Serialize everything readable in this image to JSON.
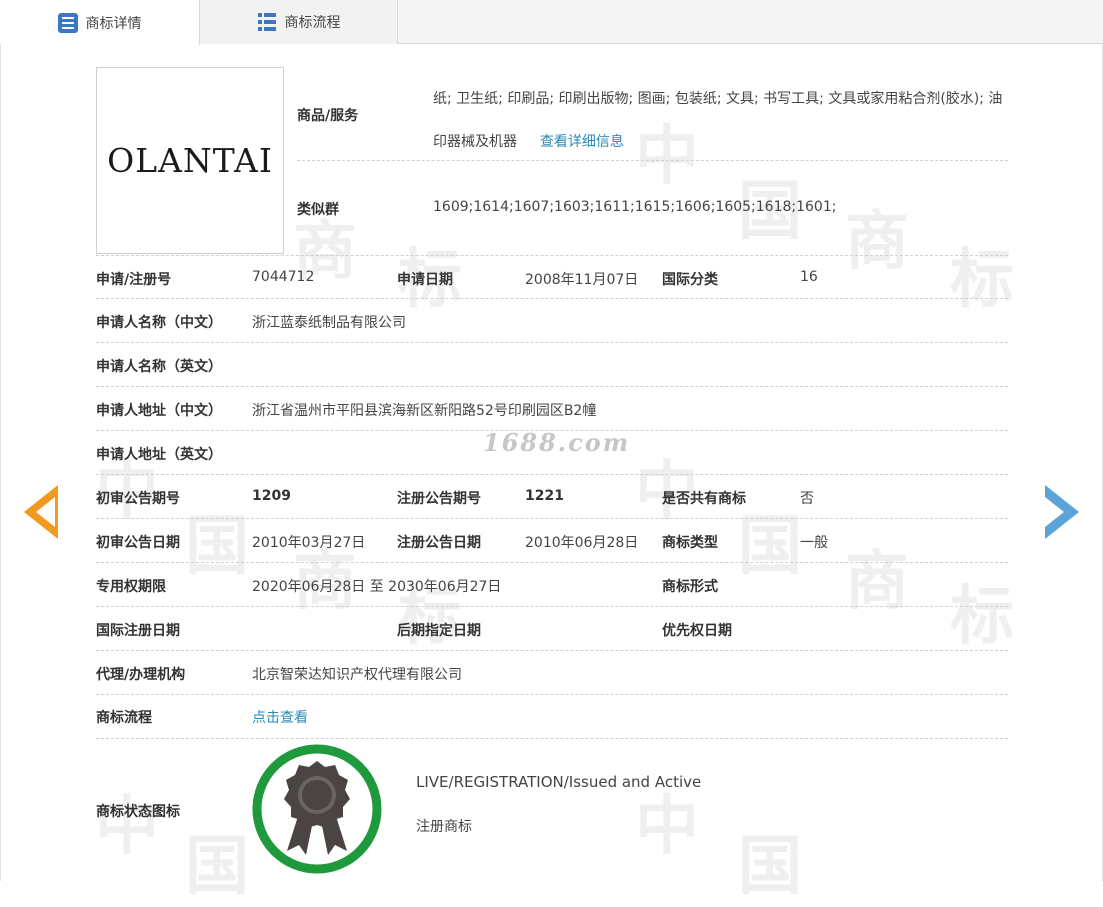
{
  "tabs": {
    "details_label": "商标详情",
    "process_label": "商标流程"
  },
  "watermark": {
    "site": "1688.com",
    "chars": [
      "中",
      "国",
      "商",
      "标"
    ]
  },
  "logo": {
    "text": "OLANTAI"
  },
  "goods": {
    "label": "商品/服务",
    "text": "纸; 卫生纸; 印刷品; 印刷出版物; 图画; 包装纸; 文具; 书写工具; 文具或家用粘合剂(胶水); 油印器械及机器",
    "more_link": "查看详细信息"
  },
  "similar_group": {
    "label": "类似群",
    "value": "1609;1614;1607;1603;1611;1615;1606;1605;1618;1601;"
  },
  "rows": {
    "reg_no_label": "申请/注册号",
    "reg_no": "7044712",
    "apply_date_label": "申请日期",
    "apply_date": "2008年11月07日",
    "intl_class_label": "国际分类",
    "intl_class": "16",
    "applicant_cn_label": "申请人名称（中文）",
    "applicant_cn": "浙江蓝泰纸制品有限公司",
    "applicant_en_label": "申请人名称（英文）",
    "applicant_en": "",
    "address_cn_label": "申请人地址（中文）",
    "address_cn": "浙江省温州市平阳县滨海新区新阳路52号印刷园区B2幢",
    "address_en_label": "申请人地址（英文）",
    "address_en": "",
    "prelim_no_label": "初审公告期号",
    "prelim_no": "1209",
    "reg_notice_no_label": "注册公告期号",
    "reg_notice_no": "1221",
    "shared_label": "是否共有商标",
    "shared": "否",
    "prelim_date_label": "初审公告日期",
    "prelim_date": "2010年03月27日",
    "reg_notice_date_label": "注册公告日期",
    "reg_notice_date": "2010年06月28日",
    "tm_type_label": "商标类型",
    "tm_type": "一般",
    "exclusive_label": "专用权期限",
    "exclusive": "2020年06月28日 至 2030年06月27日",
    "tm_form_label": "商标形式",
    "tm_form": "",
    "intl_reg_date_label": "国际注册日期",
    "intl_reg_date": "",
    "later_designation_label": "后期指定日期",
    "later_designation": "",
    "priority_date_label": "优先权日期",
    "priority_date": "",
    "agent_label": "代理/办理机构",
    "agent": "北京智荣达知识产权代理有限公司",
    "process_label": "商标流程",
    "process_link": "点击查看",
    "status_icon_label": "商标状态图标",
    "status_en": "LIVE/REGISTRATION/Issued and Active",
    "status_cn": "注册商标"
  },
  "colors": {
    "link": "#2a8ab8",
    "badge_ring": "#1e9a3c",
    "arrow_prev": "#f39a1e",
    "arrow_next": "#5ba3d9",
    "tab_icon": "#3a78c6"
  },
  "icons": {
    "details_tab": "document-list-icon",
    "process_tab": "list-icon",
    "status": "award-ribbon-icon",
    "prev": "arrow-left-icon",
    "next": "arrow-right-icon"
  }
}
